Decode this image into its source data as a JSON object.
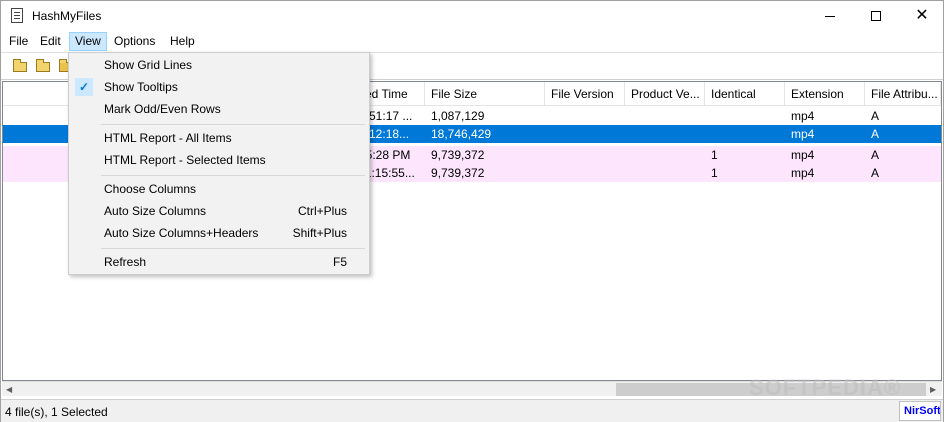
{
  "window": {
    "title": "HashMyFiles"
  },
  "menubar": {
    "items": [
      "File",
      "Edit",
      "View",
      "Options",
      "Help"
    ],
    "active": "View"
  },
  "toolbar": {
    "icons": [
      "open-folder-icon",
      "folder-icon",
      "add-files-icon"
    ]
  },
  "columns": [
    "Modified Time",
    "File Size",
    "File Version",
    "Product Version",
    "Identical",
    "Extension",
    "File Attributes"
  ],
  "column_display": [
    "fied Time",
    "File Size",
    "File Version",
    "Product Ve...",
    "Identical",
    "Extension",
    "File Attribu..."
  ],
  "rows": [
    {
      "modified": "2:51:17 ...",
      "size": "1,087,129",
      "version": "",
      "product": "",
      "identical": "",
      "ext": "mp4",
      "attr": "A",
      "style": "normal"
    },
    {
      "modified": "0:12:18...",
      "size": "18,746,429",
      "version": "",
      "product": "",
      "identical": "",
      "ext": "mp4",
      "attr": "A",
      "style": "selected"
    },
    {
      "modified": "05:28 PM",
      "size": "9,739,372",
      "version": "",
      "product": "",
      "identical": "1",
      "ext": "mp4",
      "attr": "A",
      "style": "pink"
    },
    {
      "modified": "11:15:55...",
      "size": "9,739,372",
      "version": "",
      "product": "",
      "identical": "1",
      "ext": "mp4",
      "attr": "A",
      "style": "pink"
    }
  ],
  "view_menu": {
    "show_grid_lines": "Show Grid Lines",
    "show_tooltips": "Show Tooltips",
    "mark_odd_even": "Mark Odd/Even Rows",
    "html_all": "HTML Report - All Items",
    "html_selected": "HTML Report - Selected Items",
    "choose_columns": "Choose Columns",
    "auto_size": "Auto Size Columns",
    "auto_size_shortcut": "Ctrl+Plus",
    "auto_size_headers": "Auto Size Columns+Headers",
    "auto_size_headers_shortcut": "Shift+Plus",
    "refresh": "Refresh",
    "refresh_shortcut": "F5",
    "checked_item": "Show Tooltips"
  },
  "status": {
    "text": "4 file(s), 1 Selected",
    "link": "NirSoft"
  },
  "watermark": "SOFTPEDIA®",
  "colors": {
    "selection": "#0078d7",
    "pink_row": "#fde6fd",
    "menu_highlight": "#cce8ff",
    "link": "#0000ff"
  }
}
